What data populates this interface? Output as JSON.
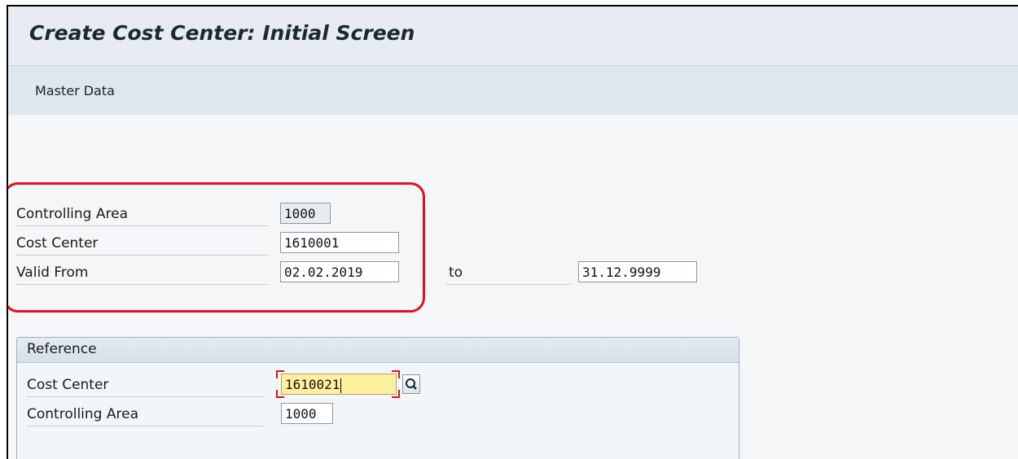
{
  "window": {
    "title": "Create Cost Center: Initial Screen"
  },
  "menu": {
    "items": [
      "Master Data"
    ]
  },
  "main": {
    "controlling_area_label": "Controlling Area",
    "controlling_area_value": "1000",
    "cost_center_label": "Cost Center",
    "cost_center_value": "1610001",
    "valid_from_label": "Valid From",
    "valid_from_value": "02.02.2019",
    "to_label": "to",
    "valid_to_value": "31.12.9999"
  },
  "reference": {
    "title": "Reference",
    "cost_center_label": "Cost Center",
    "cost_center_value": "1610021",
    "controlling_area_label": "Controlling Area",
    "controlling_area_value": "1000"
  },
  "colors": {
    "highlight": "#e3101c",
    "focus_field": "#ffef9e",
    "header_bg": "#e6ecf2"
  },
  "icons": {
    "search": "magnifier-icon"
  }
}
